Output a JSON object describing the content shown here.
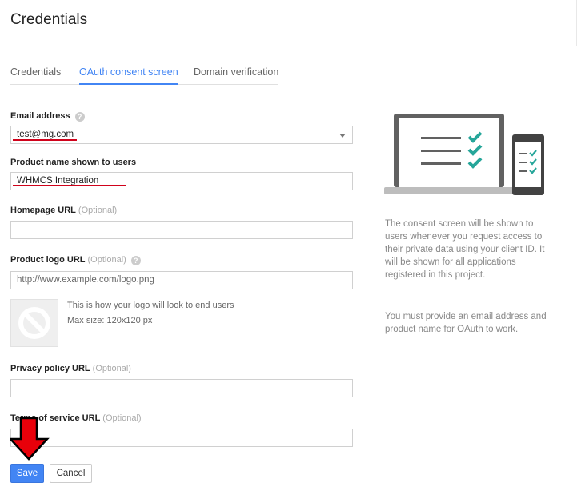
{
  "header": {
    "title": "Credentials"
  },
  "tabs": [
    {
      "label": "Credentials",
      "active": false
    },
    {
      "label": "OAuth consent screen",
      "active": true
    },
    {
      "label": "Domain verification",
      "active": false
    }
  ],
  "form": {
    "email": {
      "label": "Email address",
      "value": "test@mg.com"
    },
    "product_name": {
      "label": "Product name shown to users",
      "value": "WHMCS Integration"
    },
    "homepage": {
      "label": "Homepage URL",
      "optional": "(Optional)",
      "value": ""
    },
    "logo_url": {
      "label": "Product logo URL",
      "optional": "(Optional)",
      "placeholder": "http://www.example.com/logo.png"
    },
    "logo_preview": {
      "line1": "This is how your logo will look to end users",
      "line2": "Max size: 120x120 px"
    },
    "privacy": {
      "label": "Privacy policy URL",
      "optional": "(Optional)",
      "value": ""
    },
    "tos": {
      "label": "Terms of service URL",
      "optional": "(Optional)",
      "value": ""
    }
  },
  "buttons": {
    "save": "Save",
    "cancel": "Cancel"
  },
  "info": {
    "p1": "The consent screen will be shown to users whenever you request access to their private data using your client ID. It will be shown for all applications registered in this project.",
    "p2": "You must provide an email address and product name for OAuth to work."
  },
  "colors": {
    "accent": "#4285f4",
    "check": "#26a69a",
    "annotation": "#d0021b"
  },
  "icons": {
    "help": "?"
  }
}
